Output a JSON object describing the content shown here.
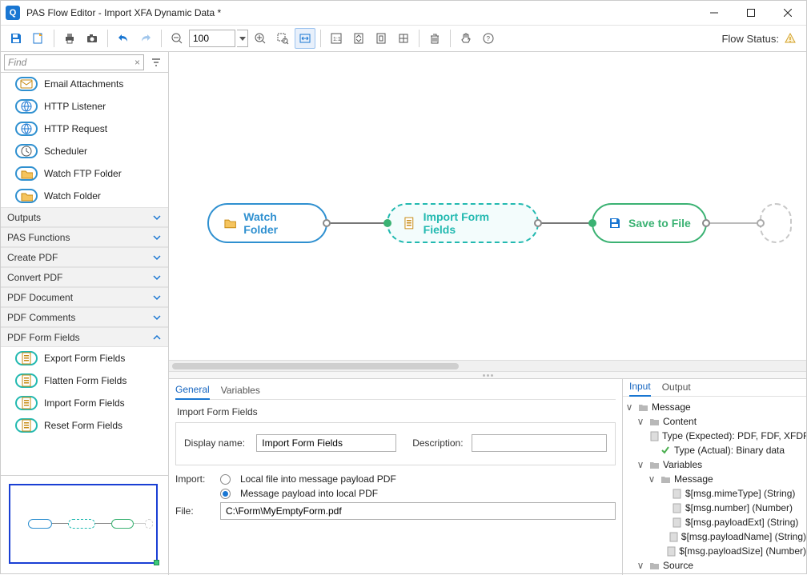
{
  "window": {
    "title": "PAS Flow Editor - Import XFA Dynamic Data *",
    "app_badge": "Q"
  },
  "toolbar": {
    "zoom_value": "100",
    "flow_status_label": "Flow Status:"
  },
  "find": {
    "placeholder": "Find"
  },
  "palette": {
    "inputs": [
      {
        "label": "Email Attachments"
      },
      {
        "label": "HTTP Listener"
      },
      {
        "label": "HTTP Request"
      },
      {
        "label": "Scheduler"
      },
      {
        "label": "Watch FTP Folder"
      },
      {
        "label": "Watch Folder"
      }
    ],
    "categories": [
      {
        "label": "Outputs",
        "expanded": false
      },
      {
        "label": "PAS Functions",
        "expanded": false
      },
      {
        "label": "Create PDF",
        "expanded": false
      },
      {
        "label": "Convert PDF",
        "expanded": false
      },
      {
        "label": "PDF Document",
        "expanded": false
      },
      {
        "label": "PDF Comments",
        "expanded": false
      },
      {
        "label": "PDF Form Fields",
        "expanded": true
      }
    ],
    "formfields": [
      {
        "label": "Export Form Fields"
      },
      {
        "label": "Flatten Form Fields"
      },
      {
        "label": "Import Form Fields"
      },
      {
        "label": "Reset Form Fields"
      }
    ]
  },
  "canvas": {
    "nodes": {
      "watch": {
        "label": "Watch Folder"
      },
      "import": {
        "label": "Import Form Fields"
      },
      "save": {
        "label": "Save to File"
      }
    }
  },
  "props": {
    "tabs": {
      "general": "General",
      "variables": "Variables"
    },
    "group_title": "Import Form Fields",
    "display_name_label": "Display name:",
    "display_name_value": "Import Form Fields",
    "description_label": "Description:",
    "description_value": "",
    "import_label": "Import:",
    "radio_local": "Local file into message payload PDF",
    "radio_payload": "Message payload into local PDF",
    "file_label": "File:",
    "file_value": "C:\\Form\\MyEmptyForm.pdf"
  },
  "io": {
    "tabs": {
      "input": "Input",
      "output": "Output"
    },
    "tree": {
      "message": "Message",
      "content": "Content",
      "type_expected": "Type (Expected): PDF, FDF, XFDF",
      "type_actual": "Type (Actual): Binary data",
      "variables": "Variables",
      "variables_message": "Message",
      "vars": [
        "$[msg.mimeType] (String)",
        "$[msg.number] (Number)",
        "$[msg.payloadExt] (String)",
        "$[msg.payloadName] (String)",
        "$[msg.payloadSize] (Number)"
      ],
      "source": "Source"
    }
  }
}
